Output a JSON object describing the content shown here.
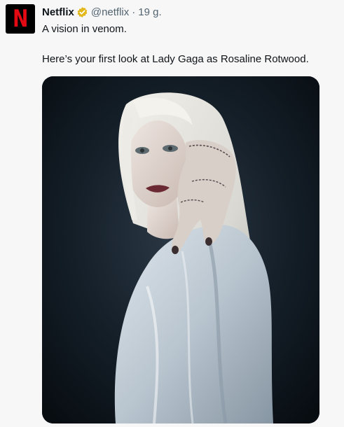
{
  "tweet": {
    "author_name": "Netflix",
    "handle": "@netflix",
    "separator": "·",
    "time": "19 g.",
    "line1": "A vision in venom.",
    "line2": "Here’s your first look at Lady Gaga as Rosaline Rotwood."
  },
  "avatar": {
    "letter": "N"
  },
  "colors": {
    "brand_red": "#e50914",
    "verified_gold": "#e2b719",
    "secondary_text": "#536471"
  },
  "icons": {
    "verified": "verified-badge-icon"
  }
}
